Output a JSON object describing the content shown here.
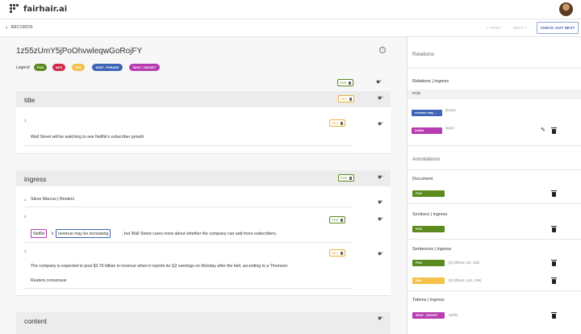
{
  "app": {
    "name": "fairhair.ai"
  },
  "subbar": {
    "back": "RECORDS",
    "prev": "< PREV",
    "next": "NEXT >",
    "checkout": "CHECK OUT NEXT"
  },
  "record": {
    "id": "1z55zUmY5jPoOhvwleqwGoRojFY",
    "info_icon": "i"
  },
  "legend": {
    "label": "Legend",
    "items": [
      {
        "label": "POS",
        "color": "#5b8a1e"
      },
      {
        "label": "NEG",
        "color": "#d02a4a"
      },
      {
        "label": "NEU",
        "color": "#f4c04a"
      },
      {
        "label": "SENT_PHRASE",
        "color": "#3e64b6"
      },
      {
        "label": "SENT_TARGET",
        "color": "#b63cb0"
      }
    ]
  },
  "doc_tag": "POS",
  "title_card": {
    "heading": "title",
    "tag": "NEU",
    "line_num": "1",
    "line_tag": "NEU",
    "text": "Wall Street will be watching to see Netflix's subscriber growth"
  },
  "ingress_card": {
    "heading": "ingress",
    "tag": "POS",
    "lines": [
      {
        "num": "1",
        "text": "Steve Marcus | Reuters"
      },
      {
        "num": "2",
        "tag": "POS",
        "target": "Netflix",
        "sep": "'s",
        "phrase": "revenue may be increasing",
        "rest": ", but Wall Street cares more about whether the company can add more subscribers."
      },
      {
        "num": "3",
        "tag": "NEU",
        "text1": "The company is expected to post $2.76 billion in revenue when it reports its Q2 earnings on Monday after the bell, according to a Thomson",
        "text2": "Reuters consensus"
      }
    ]
  },
  "content_card": {
    "heading": "content"
  },
  "right": {
    "relations_title": "Relations",
    "relations_sub": "Relations | ingress",
    "pos_label": "POS",
    "relations": [
      {
        "badge": "revenue may ...",
        "note": "phrase",
        "color": "#3e64b6"
      },
      {
        "badge": "Netflix",
        "note": "target",
        "color": "#b63cb0"
      }
    ],
    "annotations_title": "Annotations",
    "document_label": "Document",
    "document_badge": "POS",
    "sections_label": "Sections | ingress",
    "sections_badge": "POS",
    "sentences_label": "Sentences | ingress",
    "sentences": [
      {
        "badge": "POS",
        "note": "[2] Offsets: (24, 138)",
        "color": "#5b8a1e"
      },
      {
        "badge": "NEU",
        "note": "[3] Offsets: (141, 286)",
        "color": "#f4c04a"
      }
    ],
    "tokens_label": "Tokens | ingress",
    "tokens": [
      {
        "badge": "SENT_TARGET",
        "note": "Netflix",
        "color": "#b63cb0"
      }
    ]
  },
  "colors": {
    "pos": "#5b8a1e",
    "neu": "#e8b23a",
    "phrase": "#3e64b6",
    "target": "#b63cb0"
  }
}
